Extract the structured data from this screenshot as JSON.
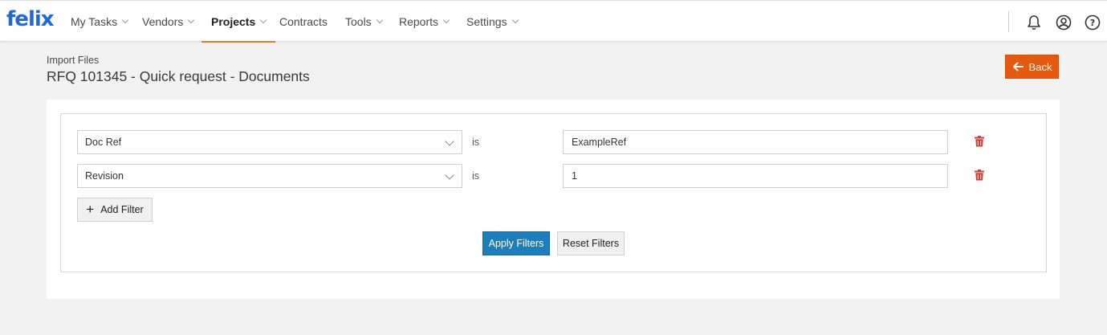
{
  "brand": {
    "logo_text": "felix",
    "color": "#1f6bd6"
  },
  "nav": {
    "items": [
      {
        "label": "My Tasks",
        "dropdown": true,
        "active": false
      },
      {
        "label": "Vendors",
        "dropdown": true,
        "active": false
      },
      {
        "label": "Projects",
        "dropdown": true,
        "active": true
      },
      {
        "label": "Contracts",
        "dropdown": false,
        "active": false
      },
      {
        "label": "Tools",
        "dropdown": true,
        "active": false
      },
      {
        "label": "Reports",
        "dropdown": true,
        "active": false
      },
      {
        "label": "Settings",
        "dropdown": true,
        "active": false
      }
    ],
    "active_color": "#e27b33",
    "icons": [
      "bell-icon",
      "user-circle-icon",
      "help-icon"
    ]
  },
  "header": {
    "breadcrumb": "Import Files",
    "title": "RFQ 101345 - Quick request - Documents",
    "back_label": "Back",
    "back_color": "#e65a0f"
  },
  "filters": {
    "rows": [
      {
        "field": "Doc Ref",
        "operator": "is",
        "value": "ExampleRef"
      },
      {
        "field": "Revision",
        "operator": "is",
        "value": "1"
      }
    ],
    "add_label": "Add Filter",
    "apply_label": "Apply Filters",
    "reset_label": "Reset Filters",
    "apply_color": "#1d7ebc",
    "delete_color": "#d63c2f"
  }
}
